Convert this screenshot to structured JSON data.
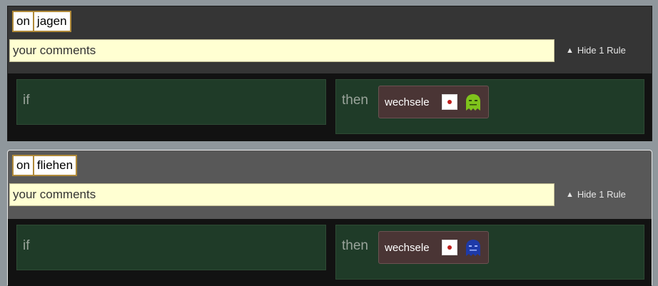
{
  "rules": [
    {
      "trigger_on": "on",
      "trigger_event": "jagen",
      "comment_placeholder": "your comments",
      "hide_label": "Hide 1 Rule",
      "if_label": "if",
      "then_label": "then",
      "action": {
        "label": "wechsele",
        "icon": "red-dot-icon",
        "target_icon": "green-ghost-icon",
        "target_color": "#7fc31c"
      }
    },
    {
      "trigger_on": "on",
      "trigger_event": "fliehen",
      "comment_placeholder": "your comments",
      "hide_label": "Hide 1 Rule",
      "if_label": "if",
      "then_label": "then",
      "action": {
        "label": "wechsele",
        "icon": "red-dot-icon",
        "target_icon": "blue-ghost-icon",
        "target_color": "#1e3aa8"
      }
    }
  ]
}
